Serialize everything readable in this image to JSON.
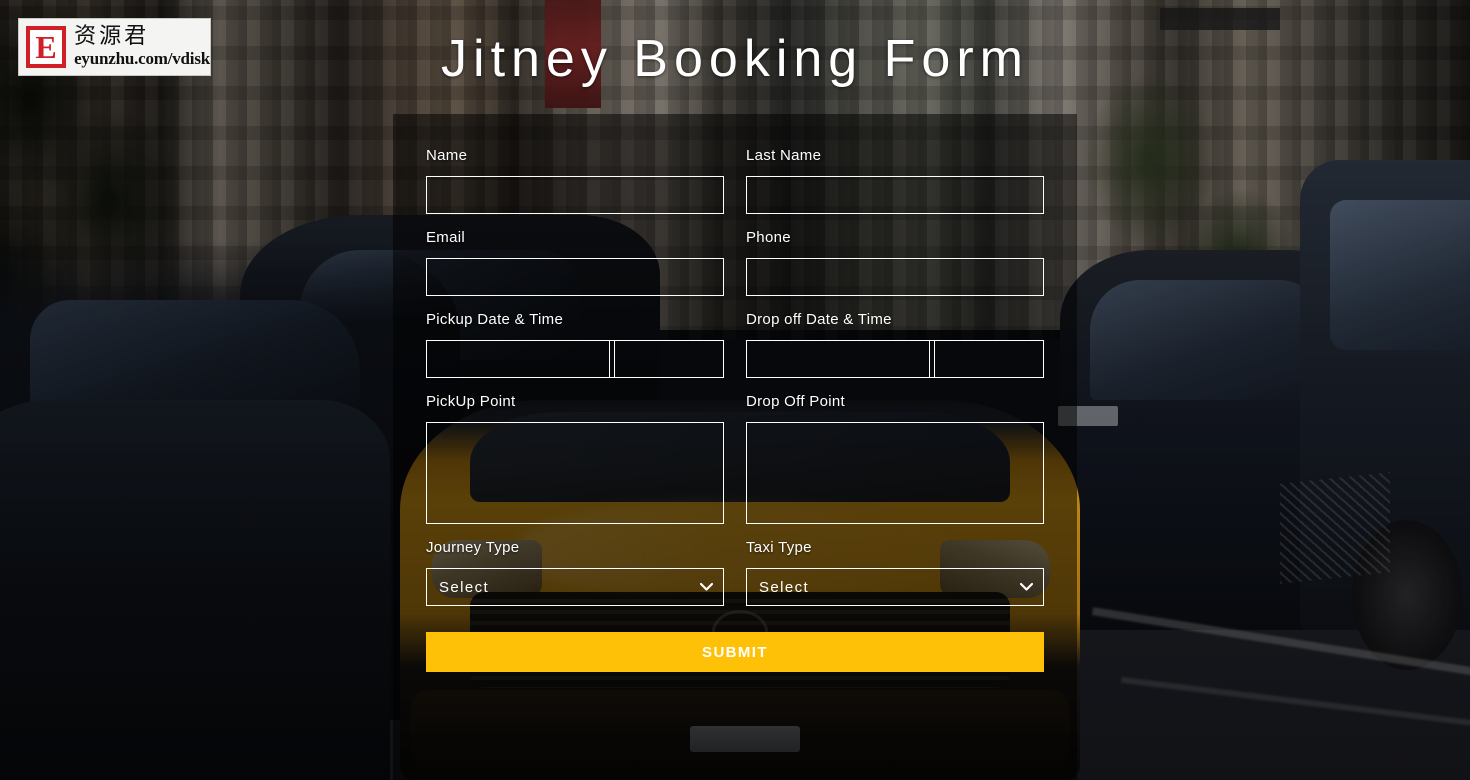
{
  "page": {
    "title": "Jitney Booking Form"
  },
  "watermark": {
    "logo_letter": "E",
    "chinese": "资源君",
    "url": "eyunzhu.com/vdisk"
  },
  "form": {
    "fields": {
      "name": {
        "label": "Name",
        "value": "",
        "placeholder": ""
      },
      "last_name": {
        "label": "Last Name",
        "value": "",
        "placeholder": ""
      },
      "email": {
        "label": "Email",
        "value": "",
        "placeholder": ""
      },
      "phone": {
        "label": "Phone",
        "value": "",
        "placeholder": ""
      },
      "pickup_datetime": {
        "label": "Pickup Date & Time",
        "date_value": "",
        "time_value": ""
      },
      "dropoff_datetime": {
        "label": "Drop off Date & Time",
        "date_value": "",
        "time_value": ""
      },
      "pickup_point": {
        "label": "PickUp Point",
        "value": "",
        "placeholder": ""
      },
      "dropoff_point": {
        "label": "Drop Off Point",
        "value": "",
        "placeholder": ""
      },
      "journey_type": {
        "label": "Journey Type",
        "selected": "Select",
        "options": [
          "Select"
        ]
      },
      "taxi_type": {
        "label": "Taxi Type",
        "selected": "Select",
        "options": [
          "Select"
        ]
      }
    },
    "submit_label": "SUBMIT"
  },
  "colors": {
    "submit_background": "#ffc107",
    "submit_text": "#ffffff",
    "field_border": "#ffffff",
    "label_text": "#ffffff",
    "panel_overlay": "rgba(0,0,0,0.52)",
    "watermark_red": "#cf2027"
  },
  "background": {
    "description": "city-street-photo-with-yellow-taxi"
  }
}
